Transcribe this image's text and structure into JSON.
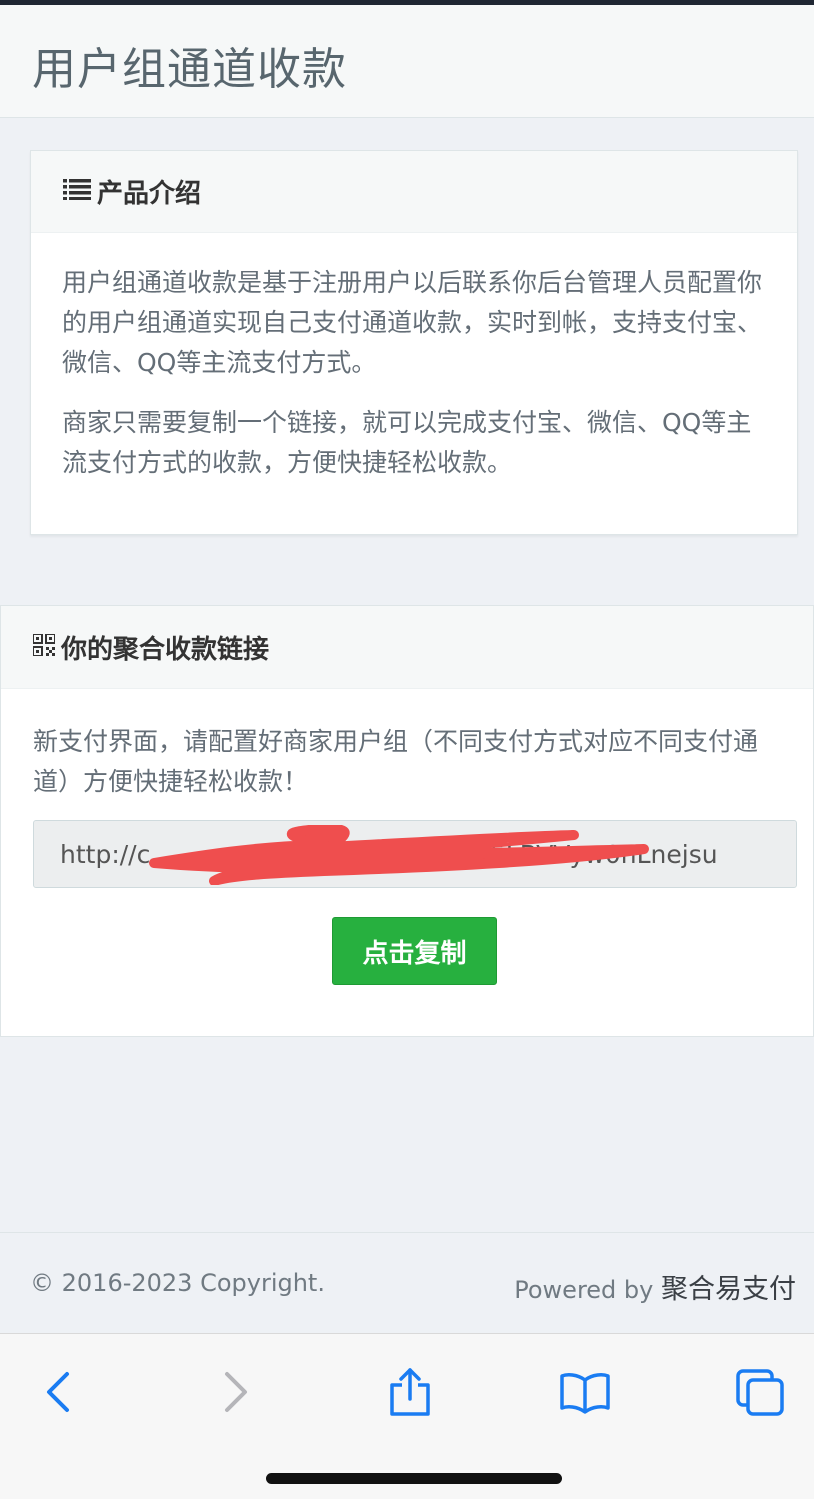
{
  "header": {
    "title": "用户组通道收款"
  },
  "intro_panel": {
    "icon": "list-icon",
    "title": "产品介绍",
    "paragraphs": [
      "用户组通道收款是基于注册用户以后联系你后台管理人员配置你的用户组通道实现自己支付通道收款，实时到帐，支持支付宝、微信、QQ等主流支付方式。",
      "商家只需要复制一个链接，就可以完成支付宝、微信、QQ等主流支付方式的收款，方便快捷轻松收款。"
    ]
  },
  "link_panel": {
    "icon": "qrcode-icon",
    "title": "你的聚合收款链接",
    "description": "新支付界面，请配置好商家用户组（不同支付方式对应不同支付通道）方便快捷轻松收款！",
    "url_value": "http://c                                   b1cb5LBVVyw0nLnejsu",
    "copy_button": "点击复制"
  },
  "footer": {
    "copyright": "© 2016-2023 Copyright.",
    "powered_prefix": "Powered by",
    "powered_name": "聚合易支付"
  },
  "browser_toolbar": {
    "buttons": [
      "back-icon",
      "forward-icon",
      "share-icon",
      "bookmarks-icon",
      "tabs-icon"
    ]
  },
  "colors": {
    "accent_green": "#27b03f",
    "safari_blue": "#1a7cf2",
    "redaction_red": "#ef4e4e"
  }
}
